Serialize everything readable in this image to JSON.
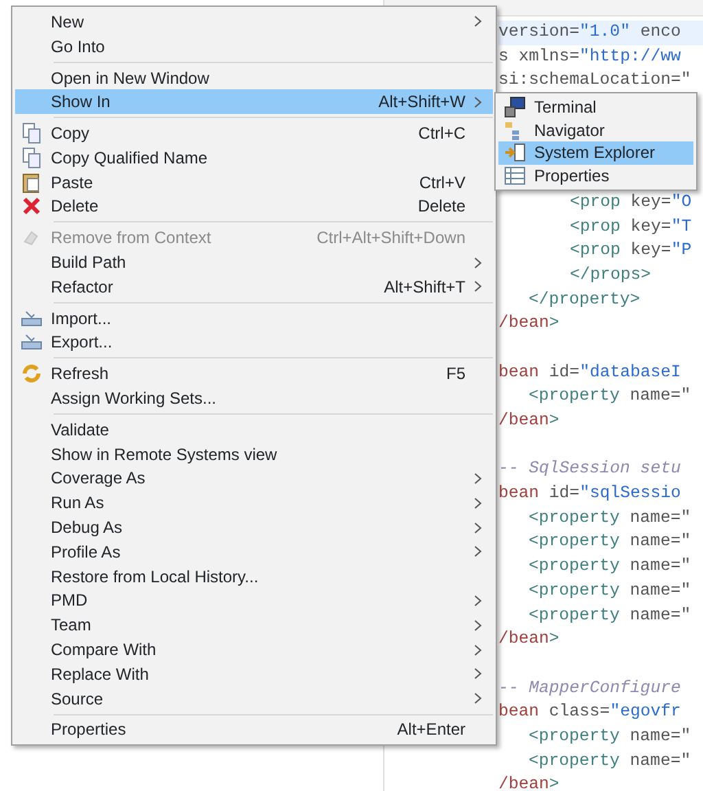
{
  "code_lines": [
    {
      "kind": "top",
      "highlighted": true,
      "segments": [
        {
          "kind": "attr",
          "text": "version="
        },
        {
          "kind": "str",
          "text": "\"1.0\""
        },
        {
          "kind": "attr",
          "text": " enco"
        }
      ]
    },
    {
      "kind": "top",
      "highlighted": false,
      "segments": [
        {
          "kind": "attr",
          "text": "s xmlns="
        },
        {
          "kind": "str",
          "text": "\"http://ww"
        }
      ]
    },
    {
      "kind": "top",
      "highlighted": false,
      "segments": [
        {
          "kind": "attr",
          "text": "si:schemaLocation=\""
        }
      ]
    },
    {
      "kind": "blank",
      "highlighted": false
    },
    {
      "kind": "blank",
      "highlighted": false
    },
    {
      "kind": "blank",
      "highlighted": false
    },
    {
      "kind": "blank",
      "highlighted": false
    },
    {
      "kind": "grandchild",
      "highlighted": false,
      "segments": [
        {
          "kind": "tag",
          "text": "<prop"
        },
        {
          "kind": "attr",
          "text": " key="
        },
        {
          "kind": "str",
          "text": "\"O"
        }
      ]
    },
    {
      "kind": "grandchild",
      "highlighted": false,
      "segments": [
        {
          "kind": "tag",
          "text": "<prop"
        },
        {
          "kind": "attr",
          "text": " key="
        },
        {
          "kind": "str",
          "text": "\"T"
        }
      ]
    },
    {
      "kind": "grandchild",
      "highlighted": false,
      "segments": [
        {
          "kind": "tag",
          "text": "<prop"
        },
        {
          "kind": "attr",
          "text": " key="
        },
        {
          "kind": "str",
          "text": "\"P"
        }
      ]
    },
    {
      "kind": "grandchild",
      "highlighted": false,
      "segments": [
        {
          "kind": "tag",
          "text": "</props>"
        }
      ]
    },
    {
      "kind": "child",
      "highlighted": false,
      "segments": [
        {
          "kind": "tag",
          "text": "</property>"
        }
      ]
    },
    {
      "kind": "top",
      "highlighted": false,
      "segments": [
        {
          "kind": "elem",
          "text": "/bean"
        },
        {
          "kind": "tag",
          "text": ">"
        }
      ]
    },
    {
      "kind": "blank",
      "highlighted": false
    },
    {
      "kind": "top",
      "highlighted": false,
      "segments": [
        {
          "kind": "elem",
          "text": "bean"
        },
        {
          "kind": "attr",
          "text": " id="
        },
        {
          "kind": "str",
          "text": "\"databaseI"
        }
      ]
    },
    {
      "kind": "child",
      "highlighted": false,
      "segments": [
        {
          "kind": "tag",
          "text": "<property"
        },
        {
          "kind": "attr",
          "text": " name=\""
        }
      ]
    },
    {
      "kind": "top",
      "highlighted": false,
      "segments": [
        {
          "kind": "elem",
          "text": "/bean"
        },
        {
          "kind": "tag",
          "text": ">"
        }
      ]
    },
    {
      "kind": "blank",
      "highlighted": false
    },
    {
      "kind": "top",
      "highlighted": false,
      "segments": [
        {
          "kind": "comment",
          "text": "-- SqlSession setu"
        }
      ]
    },
    {
      "kind": "top",
      "highlighted": false,
      "segments": [
        {
          "kind": "elem",
          "text": "bean"
        },
        {
          "kind": "attr",
          "text": " id="
        },
        {
          "kind": "str",
          "text": "\"sqlSessio"
        }
      ]
    },
    {
      "kind": "child",
      "highlighted": false,
      "segments": [
        {
          "kind": "tag",
          "text": "<property"
        },
        {
          "kind": "attr",
          "text": " name=\""
        }
      ]
    },
    {
      "kind": "child",
      "highlighted": false,
      "segments": [
        {
          "kind": "tag",
          "text": "<property"
        },
        {
          "kind": "attr",
          "text": " name=\""
        }
      ]
    },
    {
      "kind": "child",
      "highlighted": false,
      "segments": [
        {
          "kind": "tag",
          "text": "<property"
        },
        {
          "kind": "attr",
          "text": " name=\""
        }
      ]
    },
    {
      "kind": "child",
      "highlighted": false,
      "segments": [
        {
          "kind": "tag",
          "text": "<property"
        },
        {
          "kind": "attr",
          "text": " name=\""
        }
      ]
    },
    {
      "kind": "child",
      "highlighted": false,
      "segments": [
        {
          "kind": "tag",
          "text": "<property"
        },
        {
          "kind": "attr",
          "text": " name=\""
        }
      ]
    },
    {
      "kind": "top",
      "highlighted": false,
      "segments": [
        {
          "kind": "elem",
          "text": "/bean"
        },
        {
          "kind": "tag",
          "text": ">"
        }
      ]
    },
    {
      "kind": "blank",
      "highlighted": false
    },
    {
      "kind": "top",
      "highlighted": false,
      "segments": [
        {
          "kind": "comment",
          "text": "-- MapperConfigure"
        }
      ]
    },
    {
      "kind": "top",
      "highlighted": false,
      "segments": [
        {
          "kind": "elem",
          "text": "bean"
        },
        {
          "kind": "attr",
          "text": " class="
        },
        {
          "kind": "str",
          "text": "\"egovfr"
        }
      ]
    },
    {
      "kind": "child",
      "highlighted": false,
      "segments": [
        {
          "kind": "tag",
          "text": "<property"
        },
        {
          "kind": "attr",
          "text": " name=\""
        }
      ]
    },
    {
      "kind": "child",
      "highlighted": false,
      "segments": [
        {
          "kind": "tag",
          "text": "<property"
        },
        {
          "kind": "attr",
          "text": " name=\""
        }
      ]
    },
    {
      "kind": "top",
      "highlighted": false,
      "segments": [
        {
          "kind": "elem",
          "text": "/bean"
        },
        {
          "kind": "tag",
          "text": ">"
        }
      ]
    }
  ],
  "context_menu": {
    "items": [
      {
        "kind": "plain",
        "label": "New",
        "has_submenu": true,
        "selected": false,
        "disabled": false
      },
      {
        "kind": "plain",
        "label": "Go Into",
        "has_submenu": false,
        "selected": false,
        "disabled": false
      },
      {
        "kind": "separator"
      },
      {
        "kind": "plain",
        "label": "Open in New Window",
        "has_submenu": false,
        "selected": false,
        "disabled": false
      },
      {
        "kind": "plain",
        "label": "Show In",
        "shortcut": "Alt+Shift+W",
        "has_submenu": true,
        "selected": true,
        "disabled": false
      },
      {
        "kind": "separator"
      },
      {
        "kind": "copy",
        "label": "Copy",
        "shortcut": "Ctrl+C",
        "has_submenu": false,
        "selected": false,
        "disabled": false
      },
      {
        "kind": "copy",
        "label": "Copy Qualified Name",
        "has_submenu": false,
        "selected": false,
        "disabled": false
      },
      {
        "kind": "paste",
        "label": "Paste",
        "shortcut": "Ctrl+V",
        "has_submenu": false,
        "selected": false,
        "disabled": false
      },
      {
        "kind": "delete",
        "label": "Delete",
        "shortcut": "Delete",
        "has_submenu": false,
        "selected": false,
        "disabled": false
      },
      {
        "kind": "separator"
      },
      {
        "kind": "remove",
        "label": "Remove from Context",
        "shortcut": "Ctrl+Alt+Shift+Down",
        "has_submenu": false,
        "selected": false,
        "disabled": true
      },
      {
        "kind": "plain",
        "label": "Build Path",
        "has_submenu": true,
        "selected": false,
        "disabled": false
      },
      {
        "kind": "plain",
        "label": "Refactor",
        "shortcut": "Alt+Shift+T",
        "has_submenu": true,
        "selected": false,
        "disabled": false
      },
      {
        "kind": "separator"
      },
      {
        "kind": "import",
        "label": "Import...",
        "has_submenu": false,
        "selected": false,
        "disabled": false
      },
      {
        "kind": "import",
        "label": "Export...",
        "has_submenu": false,
        "selected": false,
        "disabled": false
      },
      {
        "kind": "separator"
      },
      {
        "kind": "refresh",
        "label": "Refresh",
        "shortcut": "F5",
        "has_submenu": false,
        "selected": false,
        "disabled": false
      },
      {
        "kind": "plain",
        "label": "Assign Working Sets...",
        "has_submenu": false,
        "selected": false,
        "disabled": false
      },
      {
        "kind": "separator"
      },
      {
        "kind": "plain",
        "label": "Validate",
        "has_submenu": false,
        "selected": false,
        "disabled": false
      },
      {
        "kind": "plain",
        "label": "Show in Remote Systems view",
        "has_submenu": false,
        "selected": false,
        "disabled": false
      },
      {
        "kind": "plain",
        "label": "Coverage As",
        "has_submenu": true,
        "selected": false,
        "disabled": false
      },
      {
        "kind": "plain",
        "label": "Run As",
        "has_submenu": true,
        "selected": false,
        "disabled": false
      },
      {
        "kind": "plain",
        "label": "Debug As",
        "has_submenu": true,
        "selected": false,
        "disabled": false
      },
      {
        "kind": "plain",
        "label": "Profile As",
        "has_submenu": true,
        "selected": false,
        "disabled": false
      },
      {
        "kind": "plain",
        "label": "Restore from Local History...",
        "has_submenu": false,
        "selected": false,
        "disabled": false
      },
      {
        "kind": "plain",
        "label": "PMD",
        "has_submenu": true,
        "selected": false,
        "disabled": false
      },
      {
        "kind": "plain",
        "label": "Team",
        "has_submenu": true,
        "selected": false,
        "disabled": false
      },
      {
        "kind": "plain",
        "label": "Compare With",
        "has_submenu": true,
        "selected": false,
        "disabled": false
      },
      {
        "kind": "plain",
        "label": "Replace With",
        "has_submenu": true,
        "selected": false,
        "disabled": false
      },
      {
        "kind": "plain",
        "label": "Source",
        "has_submenu": true,
        "selected": false,
        "disabled": false
      },
      {
        "kind": "separator"
      },
      {
        "kind": "plain",
        "label": "Properties",
        "shortcut": "Alt+Enter",
        "has_submenu": false,
        "selected": false,
        "disabled": false
      }
    ]
  },
  "submenu": {
    "items": [
      {
        "kind": "terminal",
        "label": "Terminal",
        "selected": false
      },
      {
        "kind": "navigator",
        "label": "Navigator",
        "selected": false
      },
      {
        "kind": "explorer",
        "label": "System Explorer",
        "selected": true
      },
      {
        "kind": "properties",
        "label": "Properties",
        "selected": false
      }
    ]
  }
}
